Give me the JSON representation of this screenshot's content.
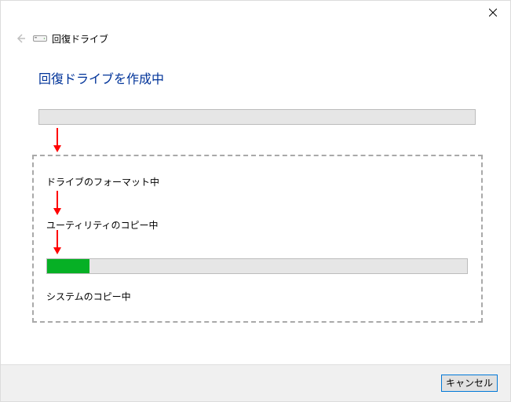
{
  "breadcrumb": "回復ドライブ",
  "heading": "回復ドライブを作成中",
  "steps": {
    "format": "ドライブのフォーマット中",
    "copy_util": "ユーティリティのコピー中",
    "copy_system": "システムのコピー中"
  },
  "progress": {
    "percent": 10
  },
  "footer": {
    "cancel": "キャンセル"
  }
}
